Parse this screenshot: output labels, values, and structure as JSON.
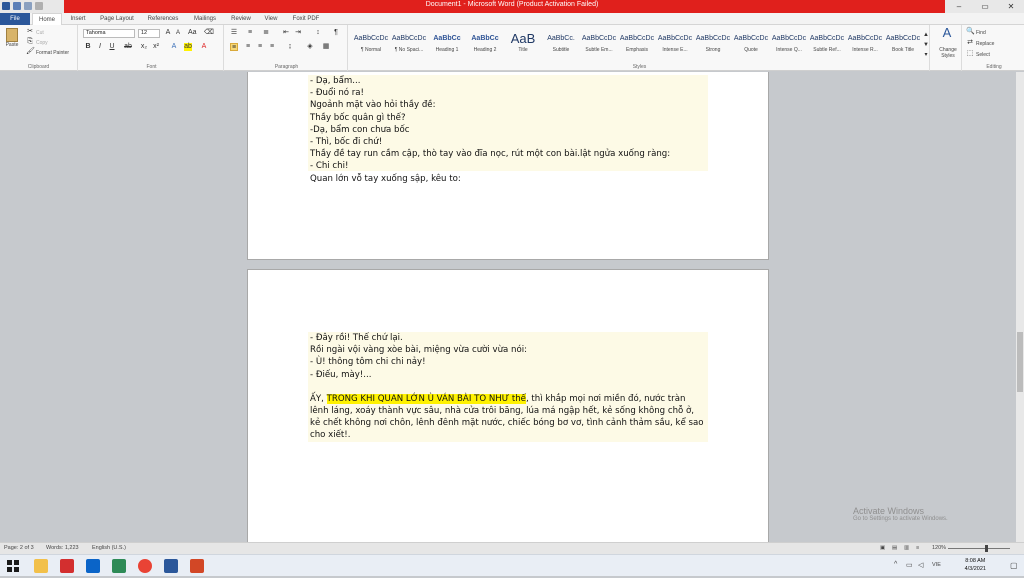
{
  "window": {
    "title": "Document1 - Microsoft Word (Product Activation Failed)"
  },
  "tabs": [
    "File",
    "Home",
    "Insert",
    "Page Layout",
    "References",
    "Mailings",
    "Review",
    "View",
    "Foxit PDF"
  ],
  "clipboard": {
    "paste": "Paste",
    "cut": "Cut",
    "copy": "Copy",
    "format_painter": "Format Painter",
    "label": "Clipboard"
  },
  "font": {
    "name": "Tahoma",
    "size": "12",
    "label": "Font"
  },
  "paragraph": {
    "label": "Paragraph"
  },
  "styles": {
    "label": "Styles",
    "items": [
      {
        "sample": "AaBbCcDc",
        "name": "¶ Normal"
      },
      {
        "sample": "AaBbCcDc",
        "name": "¶ No Spaci..."
      },
      {
        "sample": "AaBbCc",
        "name": "Heading 1"
      },
      {
        "sample": "AaBbCc",
        "name": "Heading 2"
      },
      {
        "sample": "AaB",
        "name": "Title"
      },
      {
        "sample": "AaBbCc.",
        "name": "Subtitle"
      },
      {
        "sample": "AaBbCcDc",
        "name": "Subtle Em..."
      },
      {
        "sample": "AaBbCcDc",
        "name": "Emphasis"
      },
      {
        "sample": "AaBbCcDc",
        "name": "Intense E..."
      },
      {
        "sample": "AaBbCcDc",
        "name": "Strong"
      },
      {
        "sample": "AaBbCcDc",
        "name": "Quote"
      },
      {
        "sample": "AaBbCcDc",
        "name": "Intense Q..."
      },
      {
        "sample": "AaBbCcDc",
        "name": "Subtle Ref..."
      },
      {
        "sample": "AaBbCcDc",
        "name": "Intense R..."
      },
      {
        "sample": "AaBbCcDc",
        "name": "Book Title"
      }
    ],
    "change_styles": "Change Styles"
  },
  "editing": {
    "find": "Find",
    "replace": "Replace",
    "select": "Select",
    "label": "Editing"
  },
  "page1_lines": [
    "- Dạ, bẩm...",
    "- Đuổi nó ra!",
    "Ngoảnh mặt vào hỏi thầy đề:",
    "Thầy bốc quân gì thế?",
    "-Dạ, bẩm con chưa bốc",
    "- Thì, bốc đi chứ!",
    "Thầy đề tay run cầm cập, thò tay vào đĩa nọc, rút một con bài.lật ngửa xuống ràng:",
    "- Chi chi!",
    "Quan lớn vỗ tay xuống sập, kêu to:"
  ],
  "page2_lines": [
    "- Đây rồi! Thế chứ lại.",
    "Rồi ngài vội vàng xòe bài, miệng vừa cười vừa nói:",
    "- Ù! thông tôm chi chi nảy!",
    "- Điếu, mày!..."
  ],
  "page2_para": {
    "before": "ẤY, ",
    "highlight": "TRONG KHI QUAN LỚN Ù VÁN BÀI TO NHƯ thế",
    "after": ", thì khắp mọi nơi miền đó, nước tràn lênh láng, xoáy thành vực sâu, nhà cửa trôi băng, lúa má ngập hết, kẻ sống không chỗ ở, kẻ chết không nơi chôn, lênh đênh mặt nước, chiếc bóng bơ vơ, tình cảnh thảm sầu, kể sao cho xiết!."
  },
  "status": {
    "page": "Page: 2 of 3",
    "words": "Words: 1,223",
    "language": "English (U.S.)",
    "zoom": "120%"
  },
  "watermark": {
    "title": "Activate Windows",
    "subtitle": "Go to Settings to activate Windows."
  },
  "clock": {
    "time": "8:08 AM",
    "date": "4/3/2021",
    "lang": "VIE"
  },
  "colors": {
    "title_bar": "#e0201c",
    "file_tab": "#2b579a",
    "highlight": "#fff200",
    "page_shading": "#fdfae6"
  }
}
